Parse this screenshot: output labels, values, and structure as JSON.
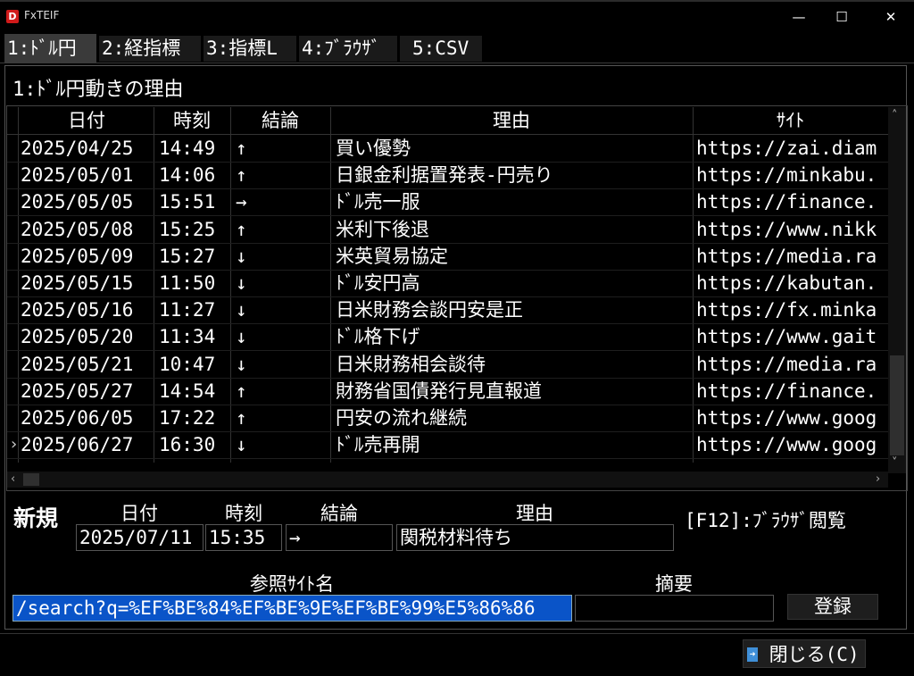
{
  "window": {
    "title": "FxTEIF",
    "logo_letter": "D",
    "minimize": "—",
    "maximize": "☐",
    "close": "✕"
  },
  "tabs": [
    {
      "label": "1:ﾄﾞﾙ円"
    },
    {
      "label": "2:経指標"
    },
    {
      "label": "3:指標L"
    },
    {
      "label": "4:ﾌﾞﾗｳｻﾞ"
    },
    {
      "label": "5:CSV"
    }
  ],
  "panel": {
    "title": "1:ﾄﾞﾙ円動きの理由"
  },
  "grid": {
    "headers": {
      "date": "日付",
      "time": "時刻",
      "dir": "結論",
      "reason": "理由",
      "site": "ｻｲﾄ"
    },
    "rows": [
      {
        "date": "2025/04/25",
        "time": "14:49",
        "dir": "↑",
        "reason": "買い優勢",
        "site": "https://zai.diam"
      },
      {
        "date": "2025/05/01",
        "time": "14:06",
        "dir": "↑",
        "reason": "日銀金利据置発表-円売り",
        "site": "https://minkabu."
      },
      {
        "date": "2025/05/05",
        "time": "15:51",
        "dir": "→",
        "reason": "ﾄﾞﾙ売一服",
        "site": "https://finance."
      },
      {
        "date": "2025/05/08",
        "time": "15:25",
        "dir": "↑",
        "reason": "米利下後退",
        "site": "https://www.nikk"
      },
      {
        "date": "2025/05/09",
        "time": "15:27",
        "dir": "↓",
        "reason": "米英貿易協定",
        "site": "https://media.ra"
      },
      {
        "date": "2025/05/15",
        "time": "11:50",
        "dir": "↓",
        "reason": "ﾄﾞﾙ安円高",
        "site": "https://kabutan."
      },
      {
        "date": "2025/05/16",
        "time": "11:27",
        "dir": "↓",
        "reason": "日米財務会談円安是正",
        "site": "https://fx.minka"
      },
      {
        "date": "2025/05/20",
        "time": "11:34",
        "dir": "↓",
        "reason": "ﾄﾞﾙ格下げ",
        "site": "https://www.gait"
      },
      {
        "date": "2025/05/21",
        "time": "10:47",
        "dir": "↓",
        "reason": "日米財務相会談待",
        "site": "https://media.ra"
      },
      {
        "date": "2025/05/27",
        "time": "14:54",
        "dir": "↑",
        "reason": "財務省国債発行見直報道",
        "site": "https://finance."
      },
      {
        "date": "2025/06/05",
        "time": "17:22",
        "dir": "↑",
        "reason": "円安の流れ継続",
        "site": "https://www.goog"
      },
      {
        "date": "2025/06/27",
        "time": "16:30",
        "dir": "↓",
        "reason": "ﾄﾞﾙ売再開",
        "site": "https://www.goog"
      }
    ],
    "current_row_marker": "›",
    "scroll_up": "˄",
    "scroll_down": "˅",
    "scroll_left": "‹",
    "scroll_right": "›"
  },
  "form": {
    "new_label": "新規",
    "date_label": "日付",
    "time_label": "時刻",
    "dir_label": "結論",
    "reason_label": "理由",
    "date_value": "2025/07/11",
    "time_value": "15:35",
    "dir_value": "→",
    "reason_value": "関税材料待ち",
    "browser_hint": "[F12]:ﾌﾞﾗｳｻﾞ閲覧",
    "site_label": "参照ｻｲﾄ名",
    "summary_label": "摘要",
    "site_value": "‎/search?q=%EF%BE%84%EF%BE%9E%EF%BE%99%E5%86%86",
    "summary_value": "",
    "register_button": "登録"
  },
  "footer": {
    "close_button": "閉じる(C)"
  }
}
